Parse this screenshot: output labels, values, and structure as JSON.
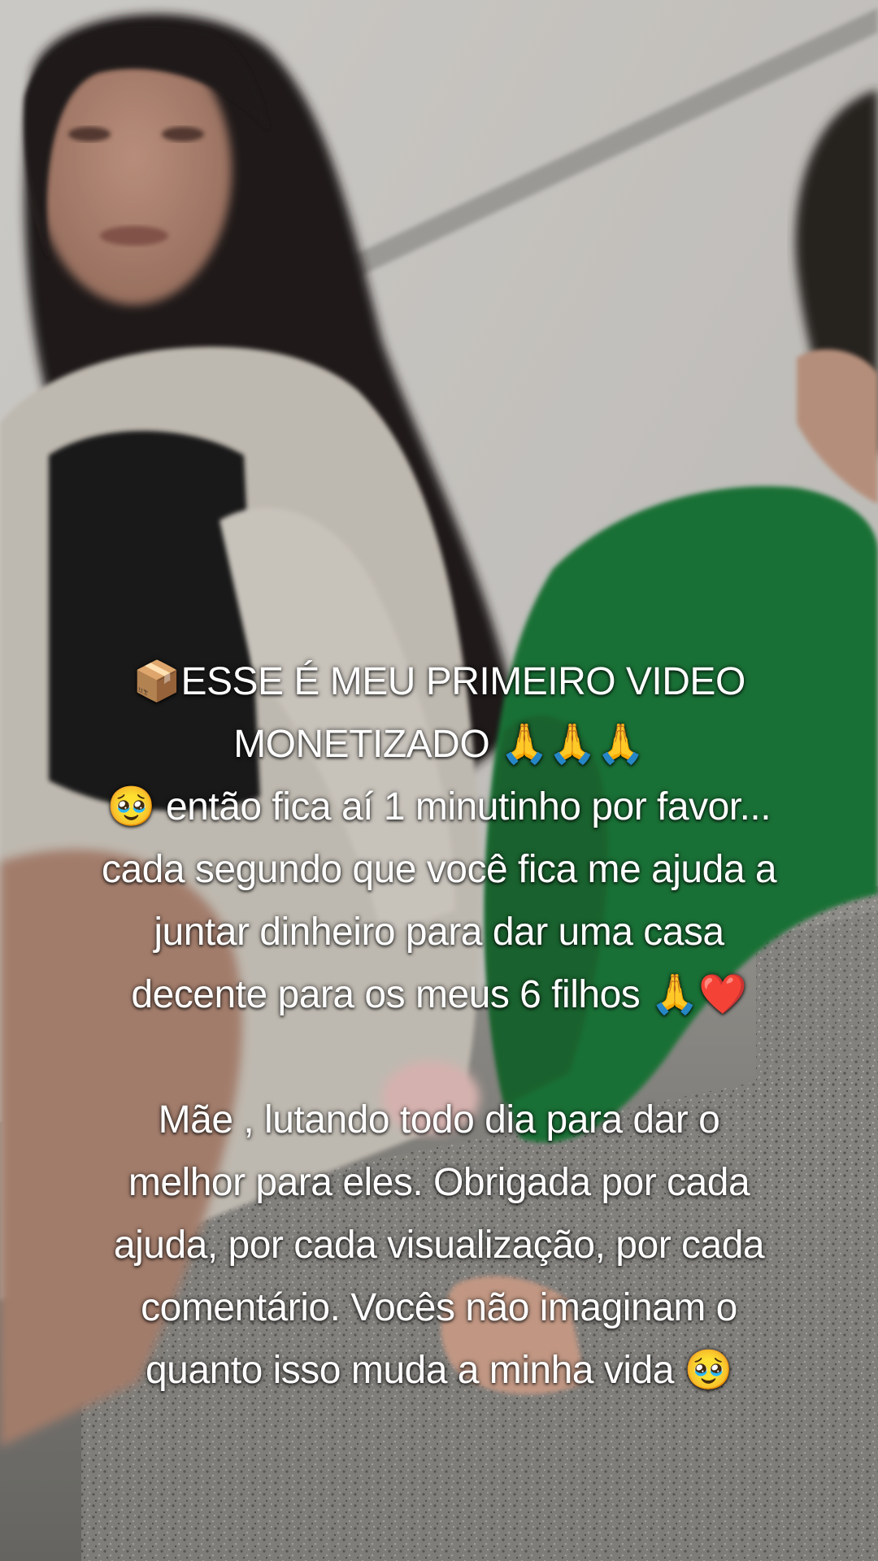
{
  "caption": {
    "lines": [
      "📦ESSE É MEU PRIMEIRO VIDEO",
      "MONETIZADO 🙏🙏🙏",
      "🥹 então fica aí 1 minutinho por favor...",
      "cada segundo que você fica me ajuda a",
      "juntar dinheiro para dar uma casa",
      "decente para os meus 6 filhos 🙏❤️",
      "",
      "Mãe , lutando todo dia para dar o",
      "melhor para eles. Obrigada por cada",
      "ajuda, por cada visualização, por cada",
      "comentário. Vocês não imaginam o",
      "quanto isso muda a minha vida 🥹"
    ]
  },
  "colors": {
    "wall": "#d6d4d0",
    "sweater": "#cfc9bf",
    "shirt_dark": "#1e1c1c",
    "hair": "#241d1b",
    "skin": "#b58a78",
    "green_shirt": "#1f7a3a",
    "granite": "#8c8a86"
  }
}
